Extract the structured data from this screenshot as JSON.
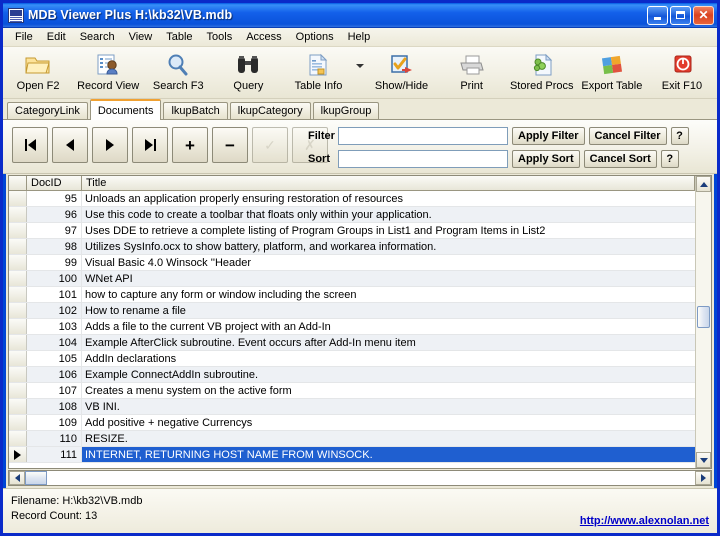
{
  "window": {
    "title": "MDB Viewer Plus H:\\kb32\\VB.mdb",
    "app_icon": "mdb-database-icon",
    "minimize_label": "_",
    "maximize_label": "□",
    "close_label": "✕"
  },
  "menu": {
    "items": [
      {
        "label": "File"
      },
      {
        "label": "Edit"
      },
      {
        "label": "Search"
      },
      {
        "label": "View"
      },
      {
        "label": "Table"
      },
      {
        "label": "Tools"
      },
      {
        "label": "Access"
      },
      {
        "label": "Options"
      },
      {
        "label": "Help"
      }
    ]
  },
  "toolbar": {
    "buttons": [
      {
        "label": "Open F2",
        "icon": "folder-open-icon"
      },
      {
        "label": "Record View",
        "icon": "record-view-icon"
      },
      {
        "label": "Search F3",
        "icon": "magnifier-icon"
      },
      {
        "label": "Query",
        "icon": "binoculars-icon"
      },
      {
        "label": "Table Info",
        "icon": "table-info-icon"
      },
      {
        "label": "Show/Hide",
        "icon": "show-hide-icon"
      },
      {
        "label": "Print",
        "icon": "printer-icon"
      },
      {
        "label": "Stored Procs",
        "icon": "stored-procs-icon"
      },
      {
        "label": "Export Table",
        "icon": "export-table-icon"
      },
      {
        "label": "Exit F10",
        "icon": "power-exit-icon"
      }
    ],
    "dropdown_icon": "chevron-down-icon"
  },
  "tabs": {
    "active": "Documents",
    "items": [
      {
        "label": "CategoryLink"
      },
      {
        "label": "Documents"
      },
      {
        "label": "lkupBatch"
      },
      {
        "label": "lkupCategory"
      },
      {
        "label": "lkupGroup"
      }
    ]
  },
  "navigator": {
    "buttons": [
      {
        "name": "first-record",
        "glyph": "|◀",
        "enabled": true
      },
      {
        "name": "previous-record",
        "glyph": "◀",
        "enabled": true
      },
      {
        "name": "next-record",
        "glyph": "▶",
        "enabled": true
      },
      {
        "name": "last-record",
        "glyph": "▶|",
        "enabled": true
      },
      {
        "name": "insert-record",
        "glyph": "+",
        "enabled": true
      },
      {
        "name": "delete-record",
        "glyph": "−",
        "enabled": true
      },
      {
        "name": "post-edit",
        "glyph": "✓",
        "enabled": false
      },
      {
        "name": "cancel-edit",
        "glyph": "✗",
        "enabled": false
      }
    ]
  },
  "filter": {
    "filter_label": "Filter",
    "filter_value": "",
    "sort_label": "Sort",
    "sort_value": "",
    "apply_filter_label": "Apply Filter",
    "cancel_filter_label": "Cancel Filter",
    "apply_sort_label": "Apply Sort",
    "cancel_sort_label": "Cancel Sort",
    "help_label": "?"
  },
  "grid": {
    "columns": [
      {
        "key": "docid",
        "label": "DocID"
      },
      {
        "key": "title",
        "label": "Title"
      }
    ],
    "selected_index": 16,
    "rows": [
      {
        "docid": "95",
        "title": "Unloads an application properly ensuring restoration of resources"
      },
      {
        "docid": "96",
        "title": "Use this code to create a toolbar that floats only within your application."
      },
      {
        "docid": "97",
        "title": "Uses DDE to retrieve a complete listing of Program Groups in List1 and Program Items in List2"
      },
      {
        "docid": "98",
        "title": "Utilizes SysInfo.ocx to show battery, platform, and workarea information."
      },
      {
        "docid": "99",
        "title": "Visual Basic 4.0 Winsock ''Header"
      },
      {
        "docid": "100",
        "title": "WNet API"
      },
      {
        "docid": "101",
        "title": "how to capture any form or window including the screen"
      },
      {
        "docid": "102",
        "title": "How to rename a file"
      },
      {
        "docid": "103",
        "title": "Adds a file to the current VB project with an Add-In"
      },
      {
        "docid": "104",
        "title": "Example AfterClick subroutine. Event occurs after Add-In menu item"
      },
      {
        "docid": "105",
        "title": "AddIn declarations"
      },
      {
        "docid": "106",
        "title": "Example ConnectAddIn subroutine."
      },
      {
        "docid": "107",
        "title": "Creates a menu system on the active form"
      },
      {
        "docid": "108",
        "title": "VB INI."
      },
      {
        "docid": "109",
        "title": "Add positive + negative Currencys"
      },
      {
        "docid": "110",
        "title": "RESIZE."
      },
      {
        "docid": "111",
        "title": "INTERNET, RETURNING HOST NAME FROM WINSOCK."
      }
    ]
  },
  "status": {
    "filename": "Filename: H:\\kb32\\VB.mdb",
    "record_count": "Record Count: 13",
    "link": "http://www.alexnolan.net"
  },
  "colors": {
    "title_bar": "#0a52da",
    "selection": "#1f5fd0",
    "active_tab_accent": "#f0a132",
    "link": "#0000c8",
    "face": "#ece9d8"
  }
}
